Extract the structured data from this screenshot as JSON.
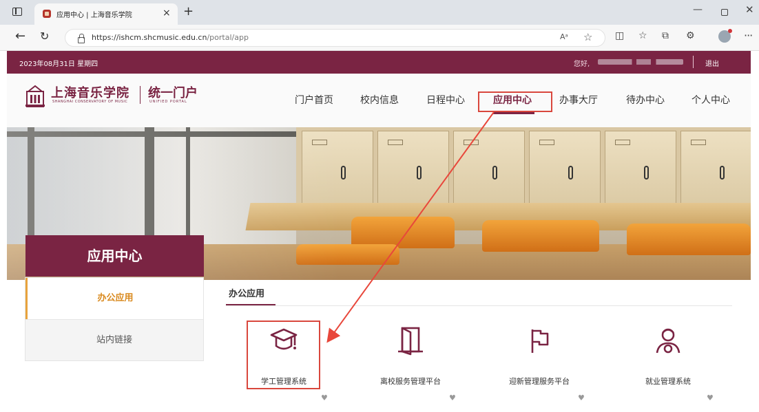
{
  "browser": {
    "tab_title": "应用中心 | 上海音乐学院",
    "url_host": "https://ishcm.shcmusic.edu.cn",
    "url_path": "/portal/app",
    "read_aloud": "Aᵃ"
  },
  "topbar": {
    "date": "2023年08月31日  星期四",
    "greeting": "您好,",
    "logout": "退出"
  },
  "logo": {
    "name_cn": "上海音乐学院",
    "name_en": "SHANGHAI CONSERVATORY OF MUSIC",
    "portal_cn": "统一门户",
    "portal_en": "UNIFIED PORTAL"
  },
  "nav": {
    "items": [
      "门户首页",
      "校内信息",
      "日程中心",
      "应用中心",
      "办事大厅",
      "待办中心",
      "个人中心"
    ],
    "active_index": 3
  },
  "sidebar": {
    "title": "应用中心",
    "items": [
      "办公应用",
      "站内链接"
    ]
  },
  "content": {
    "tab": "办公应用",
    "apps": [
      {
        "label": "学工管理系统",
        "icon": "graduation-cap-icon"
      },
      {
        "label": "离校服务管理平台",
        "icon": "door-icon"
      },
      {
        "label": "迎新管理服务平台",
        "icon": "flag-icon"
      },
      {
        "label": "就业管理系统",
        "icon": "employee-icon"
      }
    ]
  },
  "colors": {
    "brand": "#7a2443",
    "accent_orange": "#d98a1f",
    "annotation_red": "#d9463c"
  }
}
